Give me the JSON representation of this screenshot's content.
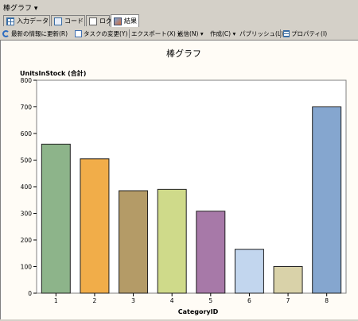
{
  "window": {
    "title": "棒グラフ",
    "title_arrow": "▾"
  },
  "tabs": [
    {
      "label": "入力データ",
      "icon": "table-icon",
      "active": false
    },
    {
      "label": "コード",
      "icon": "code-icon",
      "active": false
    },
    {
      "label": "ログ",
      "icon": "log-icon",
      "active": false
    },
    {
      "label": "結果",
      "icon": "result-chart-icon",
      "active": true
    }
  ],
  "toolbar": {
    "refresh": "最新の情報に更新(R)",
    "save_changes": "タスクの変更(Y)",
    "export": "エクスポート(X) ▾",
    "send": "送信(N) ▾",
    "create": "作成(C) ▾",
    "publish": "パブリッシュ(L)",
    "properties": "プロパティ(I)"
  },
  "colors": {
    "background": "#fffcf6",
    "bar_stroke": "#202020"
  },
  "chart_data": {
    "type": "bar",
    "title": "棒グラフ",
    "ylabel": "UnitsInStock (合計)",
    "xlabel": "CategoryID",
    "categories": [
      "1",
      "2",
      "3",
      "4",
      "5",
      "6",
      "7",
      "8"
    ],
    "values": [
      560,
      505,
      385,
      390,
      308,
      165,
      100,
      700
    ],
    "colors": [
      "#8db48a",
      "#f1ad49",
      "#b49b67",
      "#cfda8a",
      "#a779a8",
      "#c2d6ee",
      "#d9d2a9",
      "#85a6cf"
    ],
    "ylim": [
      0,
      800
    ],
    "yticks": [
      "0",
      "100",
      "200",
      "300",
      "400",
      "500",
      "600",
      "700",
      "800"
    ],
    "grid": false,
    "legend": "none"
  }
}
